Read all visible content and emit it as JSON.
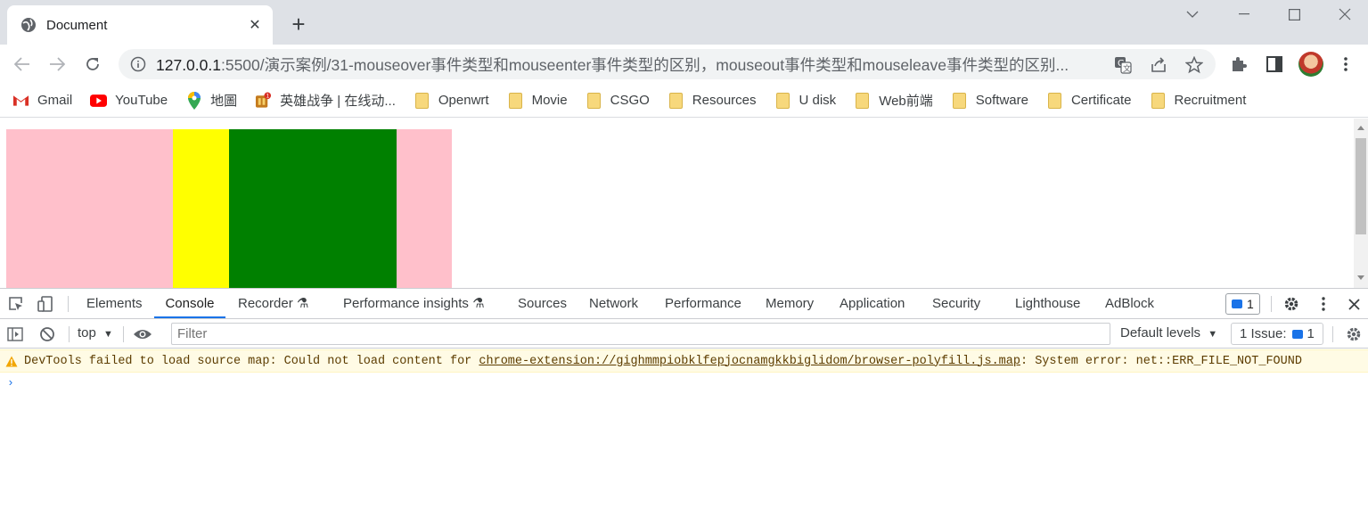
{
  "tab": {
    "title": "Document",
    "favicon": "globe-icon",
    "close": "✕"
  },
  "new_tab": "+",
  "window_controls": [
    "chevron-down-icon",
    "minimize-icon",
    "maximize-icon",
    "close-icon"
  ],
  "toolbar": {
    "url_host": "127.0.0.1",
    "url_rest": ":5500/演示案例/31-mouseover事件类型和mouseenter事件类型的区别，mouseout事件类型和mouseleave事件类型的区别..."
  },
  "bookmarks": [
    {
      "label": "Gmail",
      "icon": "gmail-icon"
    },
    {
      "label": "YouTube",
      "icon": "youtube-icon"
    },
    {
      "label": "地圖",
      "icon": "maps-icon"
    },
    {
      "label": "英雄战争 | 在线动...",
      "icon": "game-icon"
    },
    {
      "label": "Openwrt",
      "icon": "folder-icon"
    },
    {
      "label": "Movie",
      "icon": "folder-icon"
    },
    {
      "label": "CSGO",
      "icon": "folder-icon"
    },
    {
      "label": "Resources",
      "icon": "folder-icon"
    },
    {
      "label": "U disk",
      "icon": "folder-icon"
    },
    {
      "label": "Web前端",
      "icon": "folder-icon"
    },
    {
      "label": "Software",
      "icon": "folder-icon"
    },
    {
      "label": "Certificate",
      "icon": "folder-icon"
    },
    {
      "label": "Recruitment",
      "icon": "folder-icon"
    }
  ],
  "page": {
    "colors": {
      "outer": "#ffc0cb",
      "yellow": "#ffff00",
      "green": "#008000"
    }
  },
  "devtools": {
    "tabs": [
      {
        "label": "Elements"
      },
      {
        "label": "Console",
        "active": true
      },
      {
        "label": "Recorder ⚗"
      },
      {
        "label": "Performance insights ⚗"
      },
      {
        "label": "Sources"
      },
      {
        "label": "Network"
      },
      {
        "label": "Performance"
      },
      {
        "label": "Memory"
      },
      {
        "label": "Application"
      },
      {
        "label": "Security"
      },
      {
        "label": "Lighthouse"
      },
      {
        "label": "AdBlock"
      }
    ],
    "message_count": "1",
    "context": "top",
    "filter_placeholder": "Filter",
    "levels": "Default levels",
    "issues_label": "1 Issue:",
    "issues_count": "1",
    "warning": {
      "prefix": "DevTools failed to load source map: Could not load content for ",
      "link": "chrome-extension://gighmmpiobklfepjocnamgkkbiglidom/browser-polyfill.js.map",
      "suffix": ": System error: net::ERR_FILE_NOT_FOUND"
    },
    "prompt": "›"
  }
}
